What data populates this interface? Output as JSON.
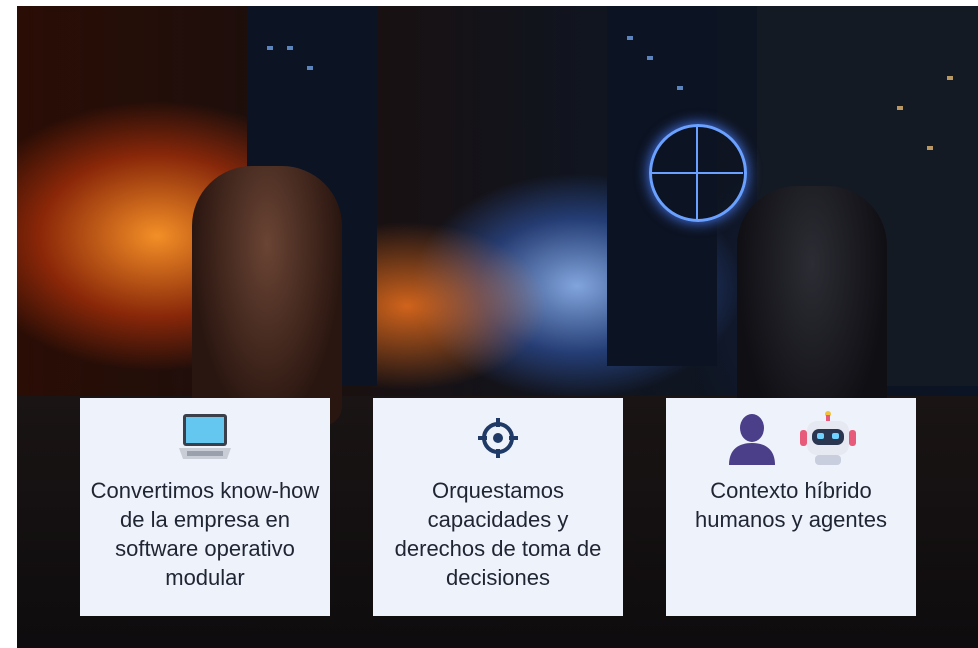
{
  "cards": [
    {
      "icons": [
        "laptop-icon"
      ],
      "text": "Convertimos know-how de la empresa en software operativo modular"
    },
    {
      "icons": [
        "target-icon"
      ],
      "text": "Orquestamos capacidades y derechos de toma de decisiones"
    },
    {
      "icons": [
        "person-silhouette-icon",
        "robot-icon"
      ],
      "text": "Contexto híbrido humanos y agentes"
    }
  ],
  "colors": {
    "card_background": "#eef2fa",
    "card_text": "#1f2533",
    "target_icon": "#1f3a66",
    "person_icon": "#4b3f8a"
  }
}
